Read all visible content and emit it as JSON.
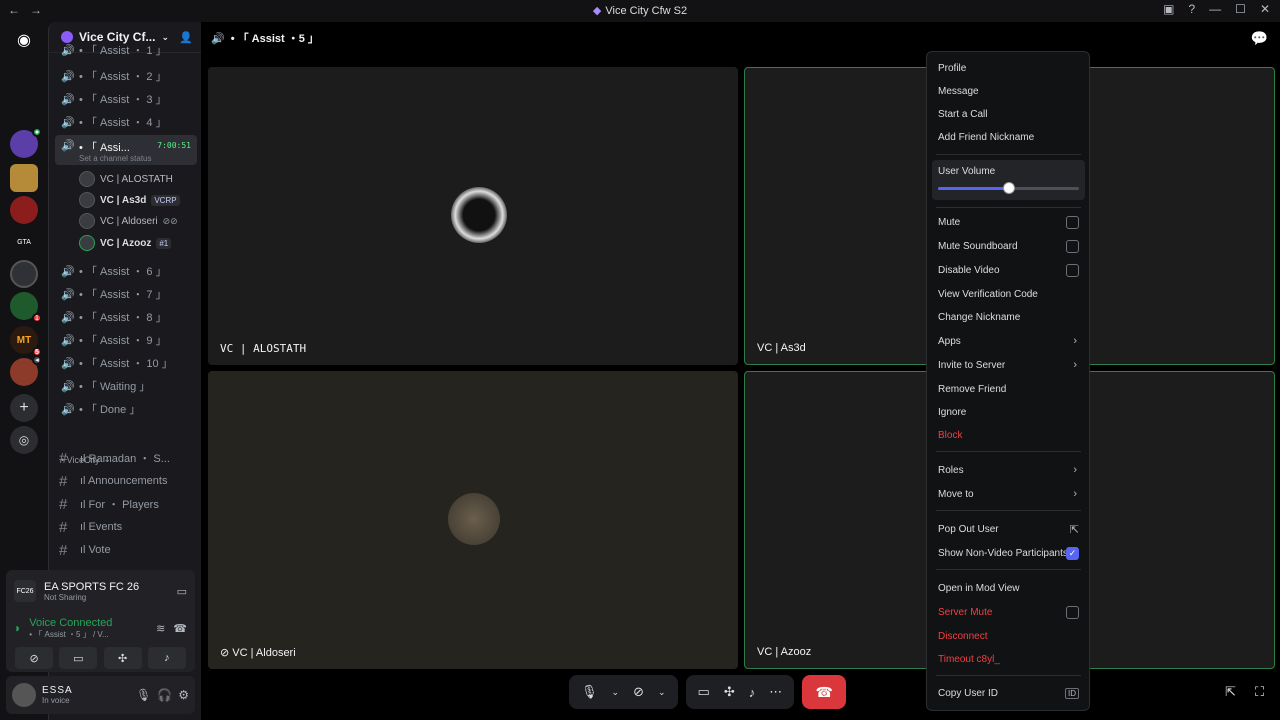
{
  "window": {
    "title": "Vice City Cfw S2"
  },
  "server": {
    "name": "Vice City Cf..."
  },
  "current_channel": "• 「 Assist ・5 」",
  "voice_channels": [
    {
      "name": "• 「 Assist ・ 1 」"
    },
    {
      "name": "• 「 Assist ・ 2 」"
    },
    {
      "name": "• 「 Assist ・ 3 」"
    },
    {
      "name": "• 「 Assist ・ 4 」"
    },
    {
      "name": "• 「 Assi...",
      "time": "7:00:51",
      "status": "Set a channel status"
    },
    {
      "name": "• 「 Assist ・ 6 」"
    },
    {
      "name": "• 「 Assist ・ 7 」"
    },
    {
      "name": "• 「 Assist ・ 8 」"
    },
    {
      "name": "• 「 Assist ・ 9 」"
    },
    {
      "name": "• 「 Assist ・ 10 」"
    },
    {
      "name": "• 「 Waiting 」"
    },
    {
      "name": "• 「 Done 」"
    }
  ],
  "voice_users": [
    {
      "name": "VC | ALOSTATH",
      "tag": ""
    },
    {
      "name": "VC | As3d",
      "tag": "VCRP"
    },
    {
      "name": "VC | Aldoseri",
      "tag": ""
    },
    {
      "name": "VC | Azooz",
      "tag": "#1"
    }
  ],
  "category": "• ViceCity",
  "text_channels": [
    {
      "name": "ıl Ramadan ・ S..."
    },
    {
      "name": "ıl Announcements"
    },
    {
      "name": "ıl For ・ Players"
    },
    {
      "name": "ıl Events"
    },
    {
      "name": "ıl Vote"
    }
  ],
  "game": {
    "name": "EA SPORTS FC 26",
    "status": "Not Sharing",
    "icon_text": "FC26"
  },
  "voice": {
    "status": "Voice Connected",
    "channel": "• 「 Assist ・5 」 / V..."
  },
  "user": {
    "name": "ESSA",
    "status": "In voice"
  },
  "tiles": [
    {
      "name": "VC | ALOSTATH"
    },
    {
      "name": "VC | As3d"
    },
    {
      "name": "VC | Aldoseri"
    },
    {
      "name": "VC | Azooz"
    }
  ],
  "menu": {
    "profile": "Profile",
    "message": "Message",
    "start_call": "Start a Call",
    "add_nickname": "Add Friend Nickname",
    "user_volume": "User Volume",
    "volume_level": 0.5,
    "mute": "Mute",
    "mute_soundboard": "Mute Soundboard",
    "disable_video": "Disable Video",
    "view_verification": "View Verification Code",
    "change_nickname": "Change Nickname",
    "apps": "Apps",
    "invite": "Invite to Server",
    "remove_friend": "Remove Friend",
    "ignore": "Ignore",
    "block": "Block",
    "roles": "Roles",
    "move_to": "Move to",
    "pop_out": "Pop Out User",
    "show_non_video": "Show Non-Video Participants",
    "mod_view": "Open in Mod View",
    "server_mute": "Server Mute",
    "disconnect": "Disconnect",
    "timeout": "Timeout c8yl_",
    "copy_id": "Copy User ID"
  },
  "colors": {
    "accent": "#5865f2",
    "danger": "#f23f43",
    "online": "#23a55a",
    "speaking": "#2d7d46"
  }
}
